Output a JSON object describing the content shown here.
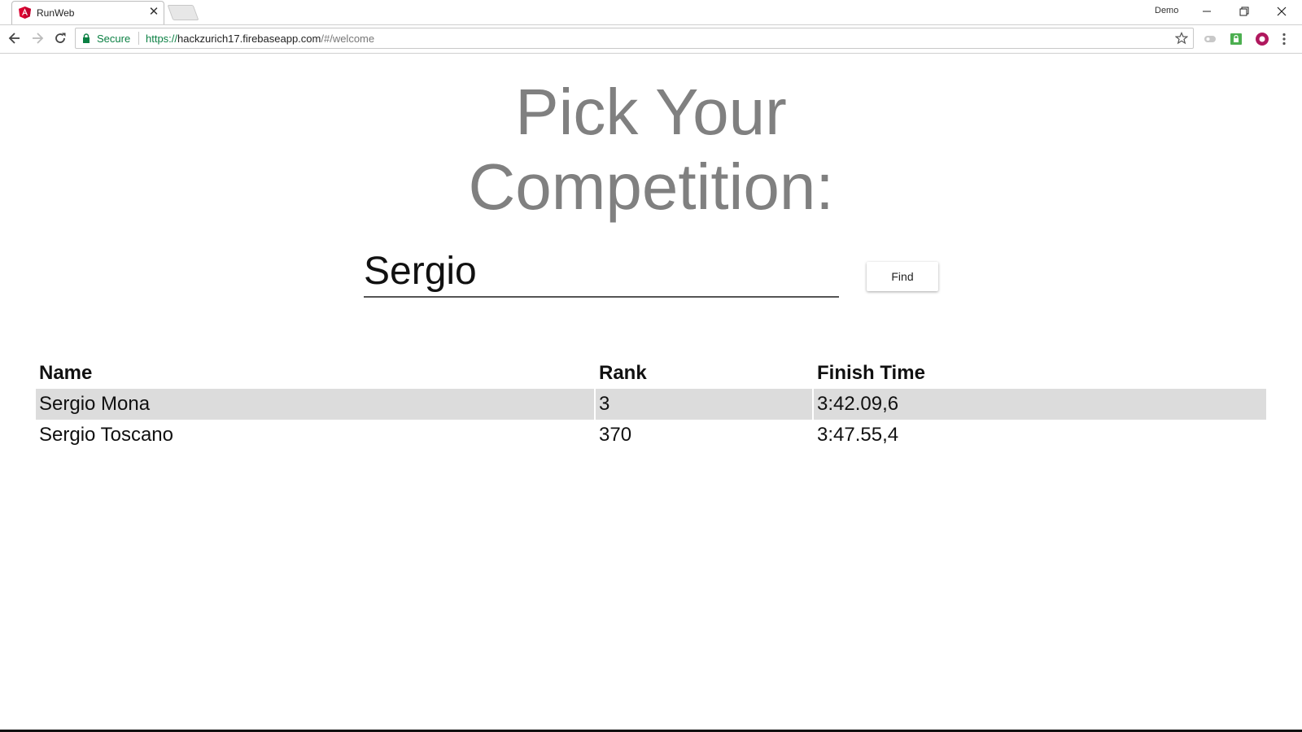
{
  "browser": {
    "tab_title": "RunWeb",
    "profile_name": "Demo",
    "secure_label": "Secure",
    "url": {
      "scheme": "https://",
      "host": "hackzurich17.firebaseapp.com",
      "path": "/#/welcome"
    }
  },
  "page": {
    "heading_line1": "Pick Your",
    "heading_line2": "Competition:",
    "search_value": "Sergio",
    "find_label": "Find",
    "table": {
      "headers": [
        "Name",
        "Rank",
        "Finish Time"
      ],
      "rows": [
        [
          "Sergio Mona",
          "3",
          "3:42.09,6"
        ],
        [
          "Sergio Toscano",
          "370",
          "3:47.55,4"
        ]
      ]
    }
  },
  "colors": {
    "heading": "#808080",
    "row_highlight": "#dcdcdc",
    "secure_green": "#0b8043",
    "angular_red": "#dd0031"
  }
}
